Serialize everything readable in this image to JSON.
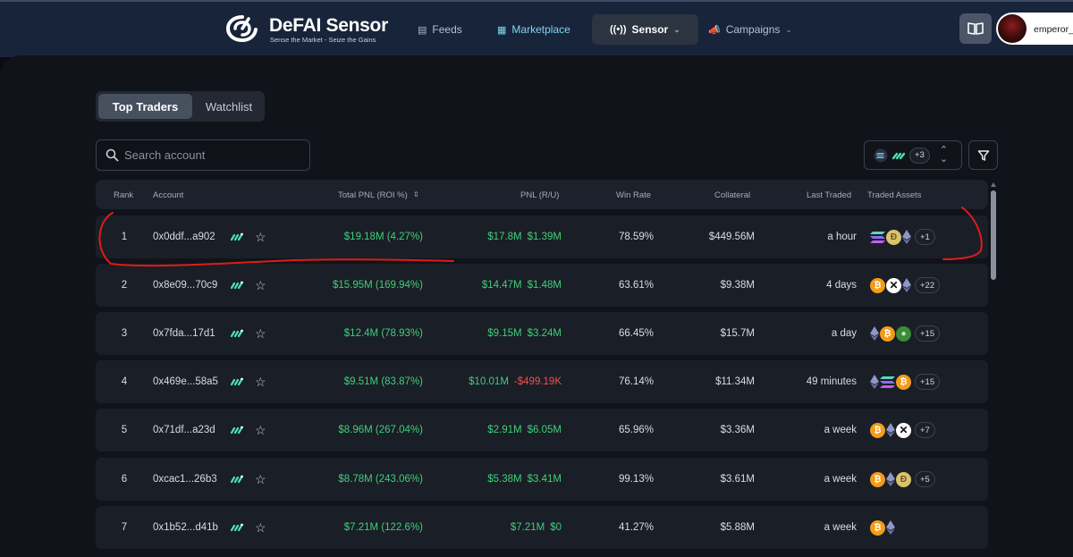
{
  "brand": {
    "name": "DeFAI Sensor",
    "tagline": "Sense the Market - Seize the Gains"
  },
  "nav": {
    "feeds": "Feeds",
    "marketplace": "Marketplace",
    "sensor": "Sensor",
    "campaigns": "Campaigns"
  },
  "user": {
    "name": "emperor_"
  },
  "tabs": {
    "active": "Top Traders",
    "inactive": "Watchlist"
  },
  "search": {
    "placeholder": "Search account",
    "value": ""
  },
  "asset_filter": {
    "more": "+3"
  },
  "table": {
    "headers": {
      "rank": "Rank",
      "account": "Account",
      "total_pnl": "Total PNL (ROI %)",
      "pnl": "PNL (R/U)",
      "win_rate": "Win Rate",
      "collateral": "Collateral",
      "last_traded": "Last Traded",
      "traded_assets": "Traded Assets"
    },
    "rows": [
      {
        "rank": "1",
        "account": "0x0ddf...a902",
        "total": "$19.18M (4.27%)",
        "realized": "$17.8M",
        "unrealized": "$1.39M",
        "unrealized_negative": false,
        "win_rate": "78.59%",
        "collateral": "$449.56M",
        "last_traded": "a hour",
        "assets": [
          "sol",
          "doge",
          "eth"
        ],
        "more": "+1"
      },
      {
        "rank": "2",
        "account": "0x8e09...70c9",
        "total": "$15.95M (169.94%)",
        "realized": "$14.47M",
        "unrealized": "$1.48M",
        "unrealized_negative": false,
        "win_rate": "63.61%",
        "collateral": "$9.38M",
        "last_traded": "4 days",
        "assets": [
          "btc",
          "x",
          "eth"
        ],
        "more": "+22"
      },
      {
        "rank": "3",
        "account": "0x7fda...17d1",
        "total": "$12.4M (78.93%)",
        "realized": "$9.15M",
        "unrealized": "$3.24M",
        "unrealized_negative": false,
        "win_rate": "66.45%",
        "collateral": "$15.7M",
        "last_traded": "a day",
        "assets": [
          "eth",
          "btc",
          "pepe"
        ],
        "more": "+15"
      },
      {
        "rank": "4",
        "account": "0x469e...58a5",
        "total": "$9.51M (83.87%)",
        "realized": "$10.01M",
        "unrealized": "-$499.19K",
        "unrealized_negative": true,
        "win_rate": "76.14%",
        "collateral": "$11.34M",
        "last_traded": "49 minutes",
        "assets": [
          "eth",
          "sol",
          "btc"
        ],
        "more": "+15"
      },
      {
        "rank": "5",
        "account": "0x71df...a23d",
        "total": "$8.96M (267.04%)",
        "realized": "$2.91M",
        "unrealized": "$6.05M",
        "unrealized_negative": false,
        "win_rate": "65.96%",
        "collateral": "$3.36M",
        "last_traded": "a week",
        "assets": [
          "btc",
          "eth",
          "x"
        ],
        "more": "+7"
      },
      {
        "rank": "6",
        "account": "0xcac1...26b3",
        "total": "$8.78M (243.06%)",
        "realized": "$5.38M",
        "unrealized": "$3.41M",
        "unrealized_negative": false,
        "win_rate": "99.13%",
        "collateral": "$3.61M",
        "last_traded": "a week",
        "assets": [
          "btc",
          "eth",
          "doge"
        ],
        "more": "+5"
      },
      {
        "rank": "7",
        "account": "0x1b52...d41b",
        "total": "$7.21M (122.6%)",
        "realized": "$7.21M",
        "unrealized": "$0",
        "unrealized_negative": false,
        "win_rate": "41.27%",
        "collateral": "$5.88M",
        "last_traded": "a week",
        "assets": [
          "btc",
          "eth"
        ],
        "more": ""
      }
    ]
  },
  "colors": {
    "positive": "#3ed07a",
    "negative": "#f0504d",
    "accent": "#7fd7f0",
    "annotation": "#e01b1b"
  }
}
